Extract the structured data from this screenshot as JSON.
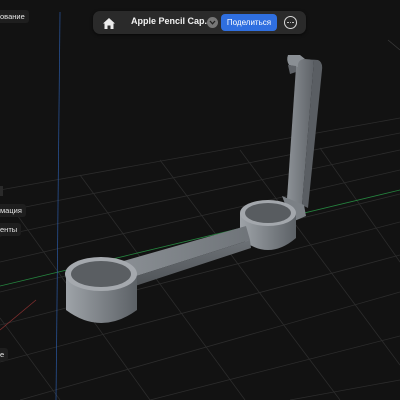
{
  "toolbar": {
    "home_icon": "home-icon",
    "document_title": "Apple Pencil Cap...",
    "title_chevron_icon": "chevron-down-icon",
    "share_label": "Поделиться",
    "share_color": "#2f6fe0",
    "more_icon": "ellipsis-circle-icon"
  },
  "left_panel": {
    "items": [
      {
        "label": "ование"
      },
      {
        "label": "мация"
      },
      {
        "label": "енты"
      },
      {
        "label": "е"
      }
    ]
  },
  "viewport": {
    "background": "#121212",
    "grid_color": "#2c2c2c",
    "axis_colors": {
      "y": "#2aa14a",
      "z": "#2d5fb0",
      "x": "#b03a3a"
    },
    "model_color": "#7d8288"
  }
}
